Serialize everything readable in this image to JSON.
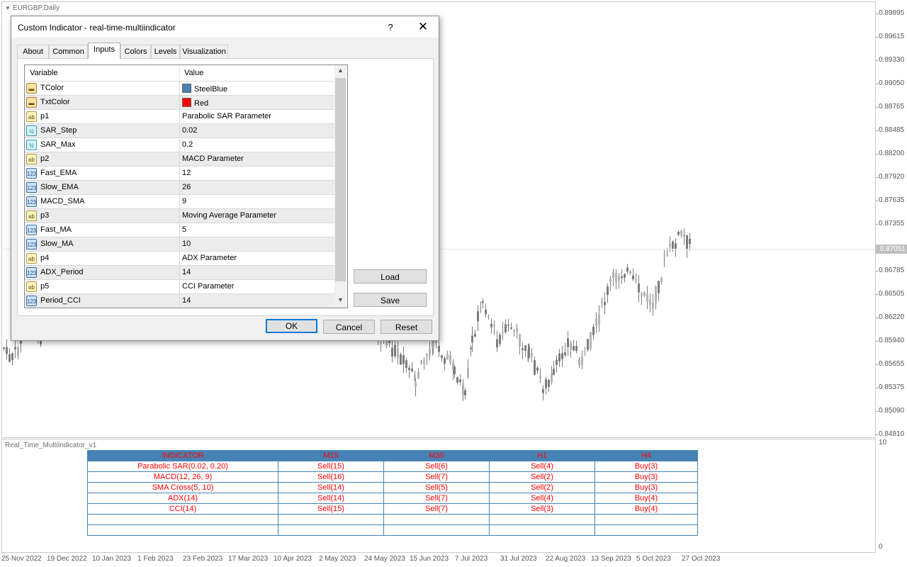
{
  "chart": {
    "title": "EURGBP,Daily",
    "price_labels": [
      "0.89895",
      "0.89615",
      "0.89330",
      "0.89050",
      "0.88765",
      "0.88485",
      "0.88200",
      "0.87920",
      "0.87635",
      "0.87355",
      "0.86785",
      "0.86505",
      "0.86220",
      "0.85940",
      "0.85655",
      "0.85375",
      "0.85090",
      "0.84810"
    ],
    "current_price": "0.87051",
    "time_labels": [
      "25 Nov 2022",
      "19 Dec 2022",
      "10 Jan 2023",
      "1 Feb 2023",
      "23 Feb 2023",
      "17 Mar 2023",
      "10 Apr 2023",
      "2 May 2023",
      "24 May 2023",
      "15 Jun 2023",
      "7 Jul 2023",
      "31 Jul 2023",
      "22 Aug 2023",
      "13 Sep 2023",
      "5 Oct 2023",
      "27 Oct 2023"
    ],
    "colors": {
      "candle": "#b4b4b4",
      "candle_dark": "#7c7c7c"
    }
  },
  "subwindow": {
    "title": "Real_Time_MultiIndicator_v1",
    "axis_top": "10",
    "axis_bottom": "0",
    "table": {
      "headers": [
        "INDICATOR",
        "M15",
        "M30",
        "H1",
        "H4"
      ],
      "rows": [
        [
          "Parabolic SAR(0.02, 0.20)",
          "Sell(15)",
          "Sell(6)",
          "Sell(4)",
          "Buy(3)"
        ],
        [
          "MACD(12, 26, 9)",
          "Sell(16)",
          "Sell(7)",
          "Sell(2)",
          "Buy(3)"
        ],
        [
          "SMA Cross(5, 10)",
          "Sell(14)",
          "Sell(5)",
          "Sell(2)",
          "Buy(3)"
        ],
        [
          "ADX(14)",
          "Sell(14)",
          "Sell(7)",
          "Sell(4)",
          "Buy(4)"
        ],
        [
          "CCI(14)",
          "Sell(15)",
          "Sell(7)",
          "Sell(3)",
          "Buy(4)"
        ],
        [
          "",
          "",
          "",
          "",
          ""
        ],
        [
          "",
          "",
          "",
          "",
          ""
        ]
      ],
      "header_bg": "#4682B4",
      "text_color": "#FF0000"
    }
  },
  "dialog": {
    "title": "Custom Indicator - real-time-multiindicator",
    "help": "?",
    "close": "✕",
    "tabs": [
      "About",
      "Common",
      "Inputs",
      "Colors",
      "Levels",
      "Visualization"
    ],
    "active_tab": "Inputs",
    "grid": {
      "col_variable": "Variable",
      "col_value": "Value",
      "rows": [
        {
          "icon": "color-icon",
          "type": "col",
          "var": "TColor",
          "val": "SteelBlue",
          "swatch": "#4682B4"
        },
        {
          "icon": "color-icon",
          "type": "col",
          "var": "TxtColor",
          "val": "Red",
          "swatch": "#FF0000"
        },
        {
          "icon": "string-icon",
          "type": "str",
          "var": "p1",
          "val": "Parabolic SAR Parameter"
        },
        {
          "icon": "double-icon",
          "type": "dbl",
          "var": "SAR_Step",
          "val": "0.02"
        },
        {
          "icon": "double-icon",
          "type": "dbl",
          "var": "SAR_Max",
          "val": "0.2"
        },
        {
          "icon": "string-icon",
          "type": "str",
          "var": "p2",
          "val": "MACD Parameter"
        },
        {
          "icon": "integer-icon",
          "type": "num",
          "var": "Fast_EMA",
          "val": "12"
        },
        {
          "icon": "integer-icon",
          "type": "num",
          "var": "Slow_EMA",
          "val": "26"
        },
        {
          "icon": "integer-icon",
          "type": "num",
          "var": "MACD_SMA",
          "val": "9"
        },
        {
          "icon": "string-icon",
          "type": "str",
          "var": "p3",
          "val": "Moving Average Parameter"
        },
        {
          "icon": "integer-icon",
          "type": "num",
          "var": "Fast_MA",
          "val": "5"
        },
        {
          "icon": "integer-icon",
          "type": "num",
          "var": "Slow_MA",
          "val": "10"
        },
        {
          "icon": "string-icon",
          "type": "str",
          "var": "p4",
          "val": "ADX Parameter"
        },
        {
          "icon": "integer-icon",
          "type": "num",
          "var": "ADX_Period",
          "val": "14"
        },
        {
          "icon": "string-icon",
          "type": "str",
          "var": "p5",
          "val": "CCI Parameter"
        },
        {
          "icon": "integer-icon",
          "type": "num",
          "var": "Period_CCI",
          "val": "14"
        }
      ]
    },
    "buttons": {
      "load": "Load",
      "save": "Save",
      "ok": "OK",
      "cancel": "Cancel",
      "reset": "Reset"
    }
  }
}
